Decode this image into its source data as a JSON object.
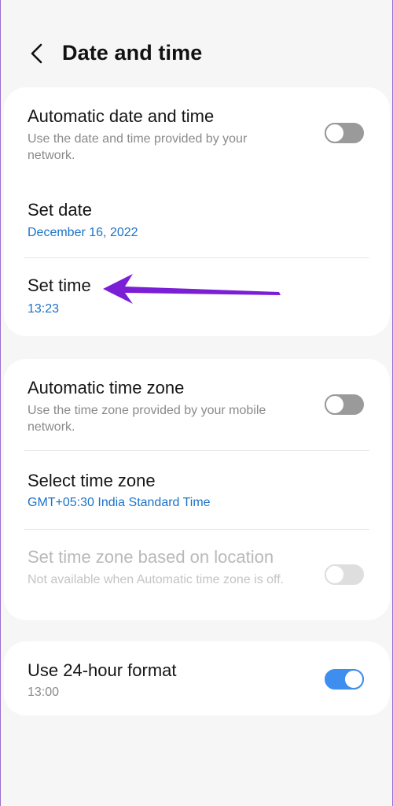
{
  "header": {
    "title": "Date and time",
    "back_icon": "chevron-left-icon"
  },
  "date_section": {
    "automatic_date_time": {
      "title": "Automatic date and time",
      "subtitle": "Use the date and time provided by your network.",
      "toggle": "off"
    },
    "set_date": {
      "title": "Set date",
      "value": "December 16, 2022"
    },
    "set_time": {
      "title": "Set time",
      "value": "13:23"
    }
  },
  "timezone_section": {
    "automatic_time_zone": {
      "title": "Automatic time zone",
      "subtitle": "Use the time zone provided by your mobile network.",
      "toggle": "off"
    },
    "select_time_zone": {
      "title": "Select time zone",
      "value": "GMT+05:30 India Standard Time"
    },
    "location_time_zone": {
      "title": "Set time zone based on location",
      "subtitle": "Not available when Automatic time zone is off.",
      "toggle": "off",
      "enabled": false
    }
  },
  "format_section": {
    "use_24_hour": {
      "title": "Use 24-hour format",
      "value": "13:00",
      "toggle": "on"
    }
  },
  "colors": {
    "accent": "#3e8ef0",
    "value_text": "#1a73c8",
    "annotation_arrow": "#7b1fd6"
  }
}
